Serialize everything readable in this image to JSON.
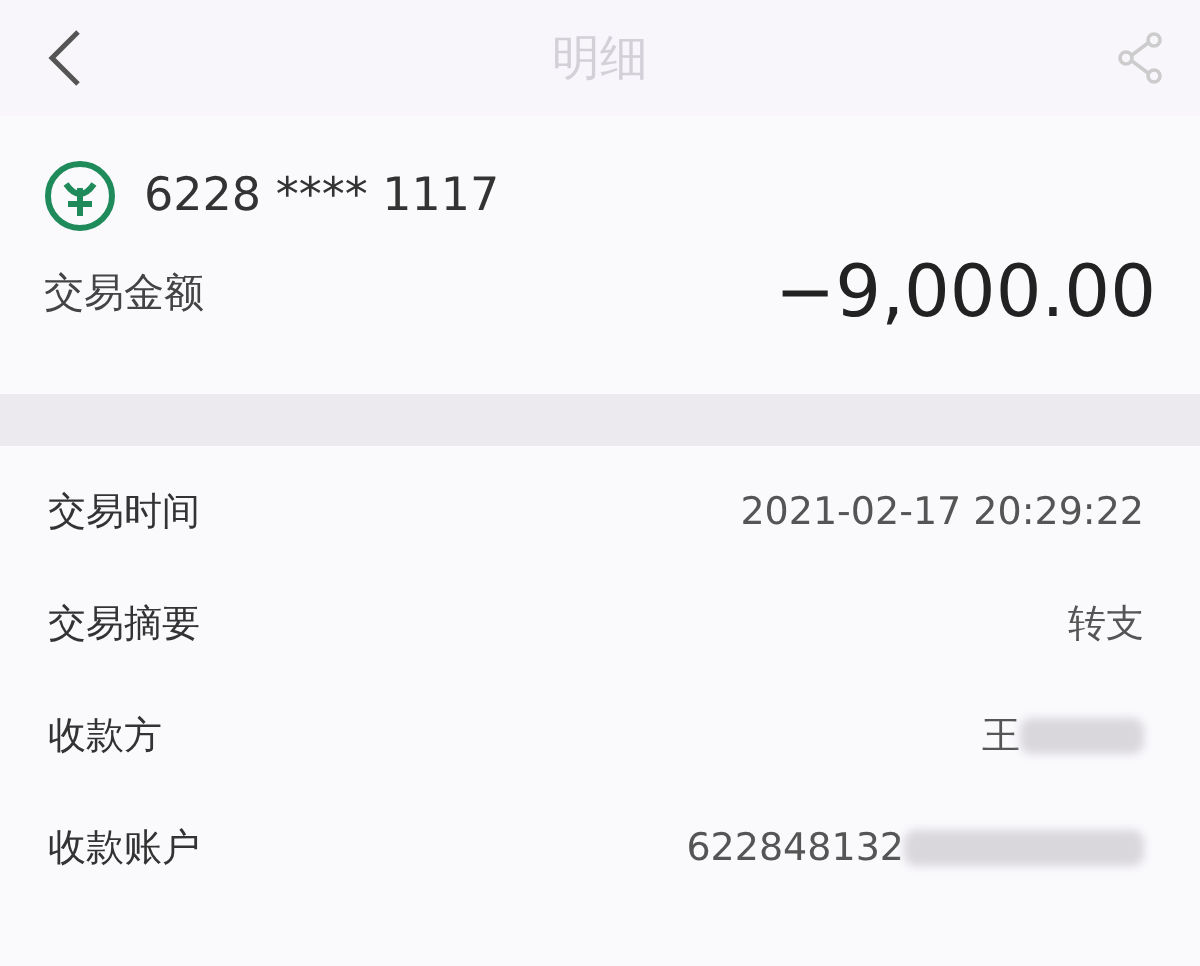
{
  "header": {
    "title": "明细"
  },
  "account": {
    "number": "6228 **** 1117"
  },
  "amount": {
    "label": "交易金额",
    "value": "−9,000.00"
  },
  "details": [
    {
      "label": "交易时间",
      "value": "2021-02-17 20:29:22",
      "redacted": false
    },
    {
      "label": "交易摘要",
      "value": "转支",
      "redacted": false
    },
    {
      "label": "收款方",
      "value": "王",
      "redacted": true
    },
    {
      "label": "收款账户",
      "value": "622848132",
      "redacted": true
    }
  ]
}
